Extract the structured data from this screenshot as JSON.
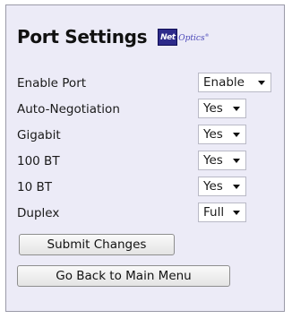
{
  "page": {
    "title": "Port Settings"
  },
  "logo": {
    "box_text": "Net",
    "text": "Optics",
    "mark": "®"
  },
  "settings": [
    {
      "label": "Enable Port",
      "value": "Enable"
    },
    {
      "label": "Auto-Negotiation",
      "value": "Yes"
    },
    {
      "label": "Gigabit",
      "value": "Yes"
    },
    {
      "label": "100 BT",
      "value": "Yes"
    },
    {
      "label": "10 BT",
      "value": "Yes"
    },
    {
      "label": "Duplex",
      "value": "Full"
    }
  ],
  "buttons": {
    "submit_label": "Submit Changes",
    "back_label": "Go Back to Main Menu"
  },
  "colors": {
    "panel_background": "#ecebf7",
    "logo_blue": "#2d2a8a"
  },
  "icons": {
    "dropdown": "chevron-down-icon",
    "logo": "net-optics-logo"
  }
}
